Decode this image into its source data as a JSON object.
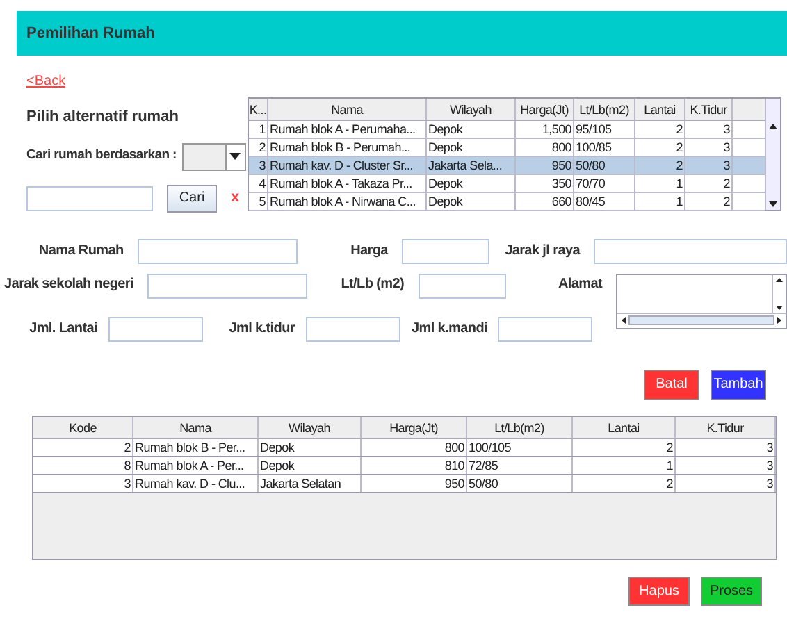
{
  "header": {
    "title": "Pemilihan Rumah"
  },
  "back_link": "<Back",
  "search_panel": {
    "title": "Pilih alternatif rumah",
    "search_by_label": "Cari rumah berdasarkan :",
    "search_button": "Cari",
    "clear_button": "x"
  },
  "house_table": {
    "columns": [
      "K...",
      "Nama",
      "Wilayah",
      "Harga(Jt)",
      "Lt/Lb(m2)",
      "Lantai",
      "K.Tidur"
    ],
    "rows": [
      {
        "cells": [
          "1",
          "Rumah blok A - Perumaha...",
          "Depok",
          "1,500",
          "95/105",
          "2",
          "3"
        ],
        "selected": false
      },
      {
        "cells": [
          "2",
          "Rumah blok B - Perumah...",
          "Depok",
          "800",
          "100/85",
          "2",
          "3"
        ],
        "selected": false
      },
      {
        "cells": [
          "3",
          "Rumah kav. D - Cluster Sr...",
          "Jakarta Sela...",
          "950",
          "50/80",
          "2",
          "3"
        ],
        "selected": true
      },
      {
        "cells": [
          "4",
          "Rumah blok A - Takaza Pr...",
          "Depok",
          "350",
          "70/70",
          "1",
          "2"
        ],
        "selected": false
      },
      {
        "cells": [
          "5",
          "Rumah blok A - Nirwana C...",
          "Depok",
          "660",
          "80/45",
          "1",
          "2"
        ],
        "selected": false
      }
    ]
  },
  "form": {
    "nama_rumah": "Nama Rumah",
    "harga": "Harga",
    "jarak_jl_raya": "Jarak jl raya",
    "jarak_sekolah": "Jarak sekolah negeri",
    "lt_lb": "Lt/Lb (m2)",
    "alamat": "Alamat",
    "jml_lantai": "Jml. Lantai",
    "jml_k_tidur": "Jml k.tidur",
    "jml_k_mandi": "Jml k.mandi"
  },
  "form_buttons": [
    "Batal",
    "Tambah"
  ],
  "selected_table": {
    "columns": [
      "Kode",
      "Nama",
      "Wilayah",
      "Harga(Jt)",
      "Lt/Lb(m2)",
      "Lantai",
      "K.Tidur"
    ],
    "rows": [
      [
        "2",
        "Rumah blok B - Per...",
        "Depok",
        "800",
        "100/105",
        "2",
        "3"
      ],
      [
        "8",
        "Rumah blok A - Per...",
        "Depok",
        "810",
        "72/85",
        "1",
        "3"
      ],
      [
        "3",
        "Rumah kav. D - Clu...",
        "Jakarta Selatan",
        "950",
        "50/80",
        "2",
        "3"
      ]
    ]
  },
  "bottom_buttons": [
    "Hapus",
    "Proses"
  ]
}
